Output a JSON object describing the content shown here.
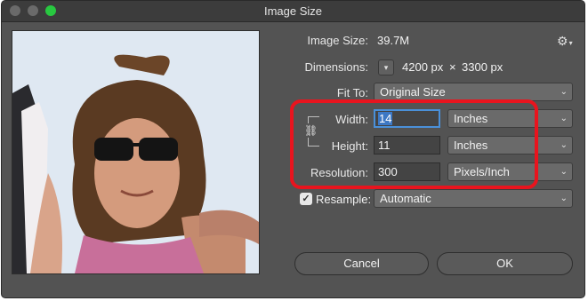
{
  "window": {
    "title": "Image Size"
  },
  "info": {
    "image_size_label": "Image Size:",
    "image_size_value": "39.7M",
    "dimensions_label": "Dimensions:",
    "dimensions_width": "4200 px",
    "dimensions_sep": "×",
    "dimensions_height": "3300 px"
  },
  "fit_to": {
    "label": "Fit To:",
    "value": "Original Size"
  },
  "width": {
    "label": "Width:",
    "value": "14",
    "unit": "Inches"
  },
  "height": {
    "label": "Height:",
    "value": "11",
    "unit": "Inches"
  },
  "resolution": {
    "label": "Resolution:",
    "value": "300",
    "unit": "Pixels/Inch"
  },
  "resample": {
    "label": "Resample:",
    "checked": true,
    "value": "Automatic"
  },
  "buttons": {
    "cancel": "Cancel",
    "ok": "OK"
  },
  "colors": {
    "accent_focus": "#4a90d9",
    "highlight": "#e8141e",
    "window_bg": "#535353"
  },
  "icons": [
    "gear-icon",
    "chevron-down-icon",
    "link-chain-icon",
    "checkmark-icon"
  ]
}
